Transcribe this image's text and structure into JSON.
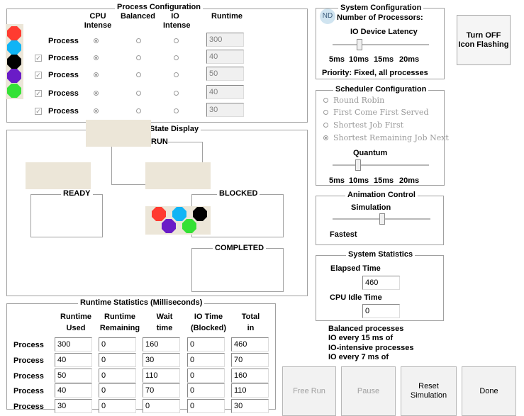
{
  "process_config": {
    "title": "Process Configuration",
    "col_cpu": "CPU Intense",
    "col_balanced": "Balanced",
    "col_io": "IO Intense",
    "col_runtime": "Runtime",
    "process_label": "Process",
    "rows": [
      {
        "runtime": "300",
        "color": "#ff3b30",
        "mode": "cpu",
        "checked": false
      },
      {
        "runtime": "40",
        "color": "#10b4f5",
        "mode": "cpu",
        "checked": true
      },
      {
        "runtime": "50",
        "color": "#000000",
        "mode": "cpu",
        "checked": true
      },
      {
        "runtime": "40",
        "color": "#6a1cc7",
        "mode": "cpu",
        "checked": true
      },
      {
        "runtime": "30",
        "color": "#35e135",
        "mode": "cpu",
        "checked": true
      }
    ]
  },
  "state_display": {
    "title": "State Display",
    "run": "RUN",
    "ready": "READY",
    "blocked": "BLOCKED",
    "completed": "COMPLETED",
    "blocked_processes": [
      {
        "color": "#ff3b30"
      },
      {
        "color": "#10b4f5"
      },
      {
        "color": "#000000"
      },
      {
        "color": "#6a1cc7"
      },
      {
        "color": "#35e135"
      }
    ]
  },
  "system_config": {
    "title": "System Configuration",
    "avatar": "ND",
    "num_processors": "Number of Processors:",
    "io_latency": "IO Device Latency",
    "ticks": [
      "5ms",
      "10ms",
      "15ms",
      "20ms"
    ],
    "priority": "Priority: Fixed, all processes"
  },
  "icon_flash_button": "Turn OFF Icon Flashing",
  "scheduler": {
    "title": "Scheduler Configuration",
    "options": [
      "Round Robin",
      "First Come First Served",
      "Shortest Job First",
      "Shortest Remaining Job Next"
    ],
    "selected_index": 3,
    "quantum": "Quantum",
    "ticks": [
      "5ms",
      "10ms",
      "15ms",
      "20ms"
    ]
  },
  "animation": {
    "title": "Animation Control",
    "simulation": "Simulation",
    "fastest": "Fastest"
  },
  "system_stats": {
    "title": "System Statistics",
    "elapsed_label": "Elapsed Time",
    "elapsed_value": "460",
    "idle_label": "CPU Idle Time",
    "idle_value": "0"
  },
  "notes": {
    "line1": "Balanced processes",
    "line2": "IO every 15 ms of",
    "line3": "IO-intensive processes",
    "line4": "IO every 7 ms of"
  },
  "runtime_stats": {
    "title": "Runtime Statistics (Milliseconds)",
    "headers": [
      [
        "Runtime",
        "Used"
      ],
      [
        "Runtime",
        "Remaining"
      ],
      [
        "Wait",
        "time"
      ],
      [
        "IO Time",
        "(Blocked)"
      ],
      [
        "Total",
        "in"
      ]
    ],
    "row_label": "Process",
    "rows": [
      [
        "300",
        "0",
        "160",
        "0",
        "460"
      ],
      [
        "40",
        "0",
        "30",
        "0",
        "70"
      ],
      [
        "50",
        "0",
        "110",
        "0",
        "160"
      ],
      [
        "40",
        "0",
        "70",
        "0",
        "110"
      ],
      [
        "30",
        "0",
        "0",
        "0",
        "30"
      ]
    ]
  },
  "buttons": {
    "free_run": "Free Run",
    "pause": "Pause",
    "reset": "Reset Simulation",
    "done": "Done"
  }
}
